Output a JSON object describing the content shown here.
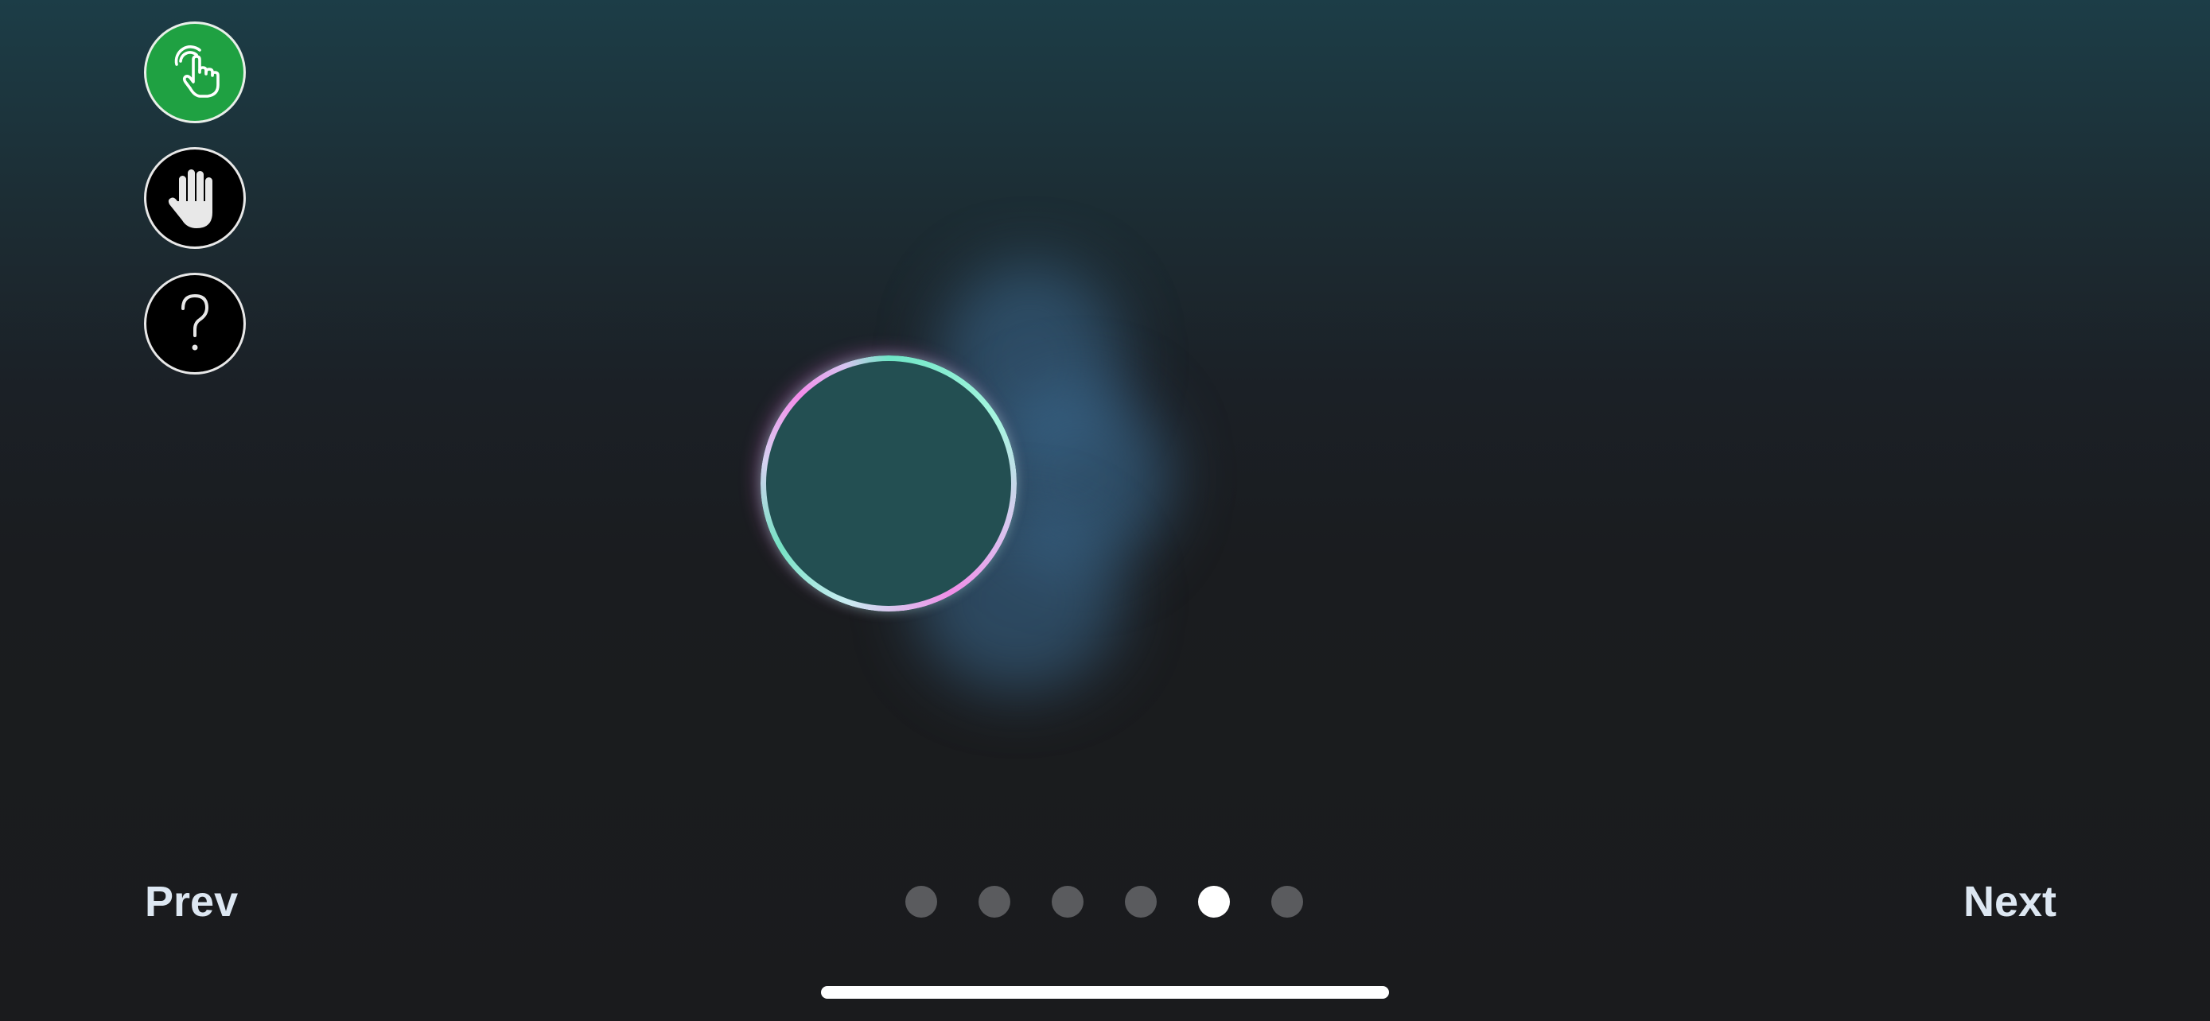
{
  "toolbar": {
    "buttons": [
      {
        "name": "tap-mode-button",
        "icon": "pointing-hand-icon",
        "state": "active",
        "color": "#1fa142"
      },
      {
        "name": "hand-mode-button",
        "icon": "raised-hand-icon",
        "state": "inactive"
      },
      {
        "name": "help-button",
        "icon": "question-mark-icon",
        "state": "inactive"
      }
    ]
  },
  "navigation": {
    "prev_label": "Prev",
    "next_label": "Next",
    "page_count": 6,
    "current_page": 5
  },
  "colors": {
    "accent_green": "#1fa142",
    "ring_fill": "#234f52",
    "ring_pink": "#f08ee8",
    "ring_teal": "#6fe6c6",
    "dot_inactive": "#5a5b5e",
    "dot_active": "#ffffff",
    "nav_text": "#dde7f2"
  }
}
